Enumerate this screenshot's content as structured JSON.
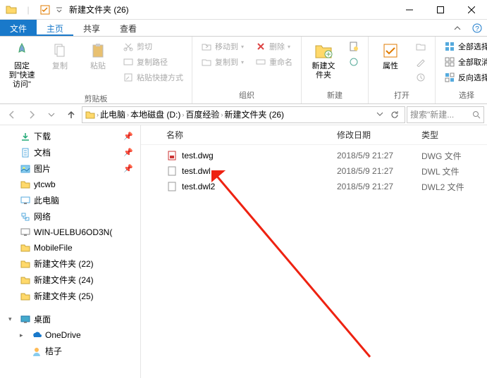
{
  "window": {
    "title": "新建文件夹 (26)"
  },
  "tabs": {
    "file": "文件",
    "home": "主页",
    "share": "共享",
    "view": "查看"
  },
  "ribbon": {
    "pin_quick": "固定到\"快速访问\"",
    "copy": "复制",
    "paste": "粘贴",
    "cut": "剪切",
    "copy_path": "复制路径",
    "paste_shortcut": "粘贴快捷方式",
    "group_clipboard": "剪贴板",
    "move_to": "移动到",
    "copy_to": "复制到",
    "delete": "删除",
    "rename": "重命名",
    "group_organize": "组织",
    "new_folder": "新建文件夹",
    "group_new": "新建",
    "properties": "属性",
    "group_open": "打开",
    "select_all": "全部选择",
    "select_none": "全部取消",
    "invert_selection": "反向选择",
    "group_select": "选择"
  },
  "breadcrumb": {
    "items": [
      "此电脑",
      "本地磁盘 (D:)",
      "百度经验",
      "新建文件夹 (26)"
    ]
  },
  "search": {
    "placeholder": "搜索\"新建..."
  },
  "nav": {
    "downloads": "下载",
    "documents": "文档",
    "pictures": "图片",
    "ytcwb": "ytcwb",
    "this_pc": "此电脑",
    "network_item": "网络",
    "win_machine": "WIN-UELBU6OD3N(",
    "mobilefile": "MobileFile",
    "nf22": "新建文件夹 (22)",
    "nf24": "新建文件夹 (24)",
    "nf25": "新建文件夹 (25)",
    "desktop": "桌面",
    "onedrive": "OneDrive",
    "juzi": "桔子"
  },
  "columns": {
    "name": "名称",
    "date": "修改日期",
    "type": "类型"
  },
  "files": [
    {
      "name": "test.dwg",
      "date": "2018/5/9 21:27",
      "type": "DWG 文件",
      "ext": "dwg"
    },
    {
      "name": "test.dwl",
      "date": "2018/5/9 21:27",
      "type": "DWL 文件",
      "ext": "gen"
    },
    {
      "name": "test.dwl2",
      "date": "2018/5/9 21:27",
      "type": "DWL2 文件",
      "ext": "gen"
    }
  ]
}
